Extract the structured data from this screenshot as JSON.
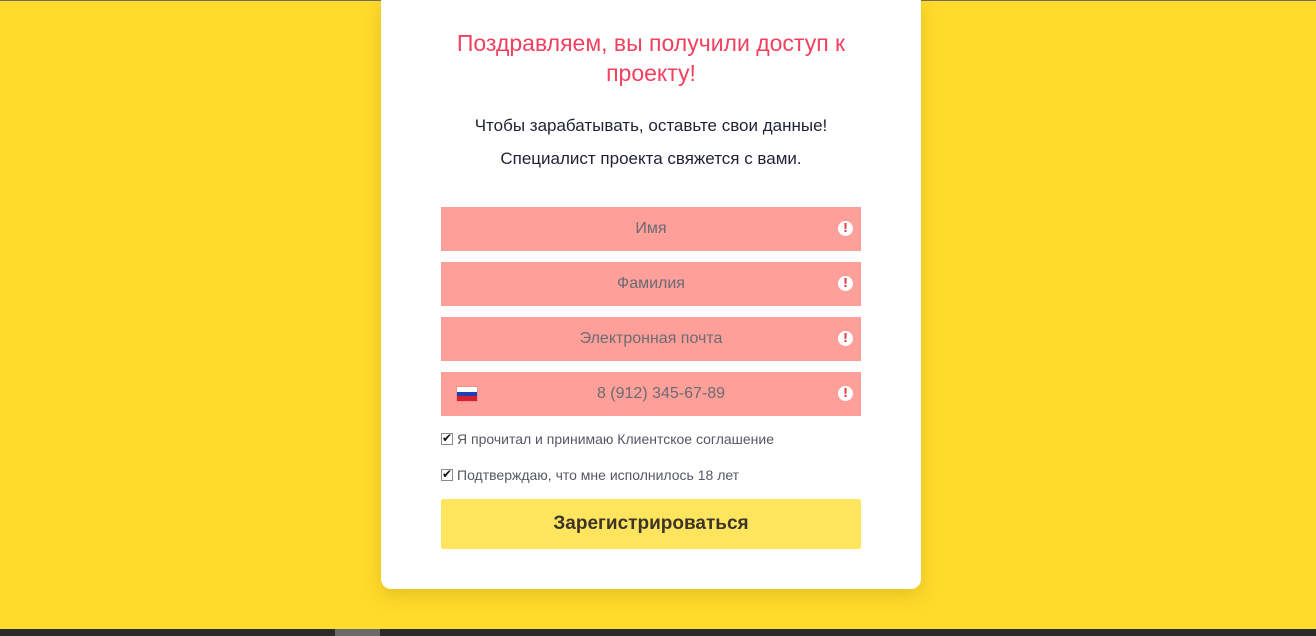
{
  "form": {
    "title": "Поздравляем, вы получили доступ к проекту!",
    "subtitle1": "Чтобы зарабатывать, оставьте свои данные!",
    "subtitle2": "Специалист проекта свяжется с вами.",
    "fields": [
      {
        "placeholder": "Имя",
        "value": "",
        "state": "error",
        "icon": "exclamation-circle-icon"
      },
      {
        "placeholder": "Фамилия",
        "value": "",
        "state": "error",
        "icon": "exclamation-circle-icon"
      },
      {
        "placeholder": "Электронная почта",
        "value": "",
        "state": "error",
        "icon": "exclamation-circle-icon"
      },
      {
        "placeholder": "8 (912) 345-67-89",
        "value": "",
        "state": "error",
        "icon": "exclamation-circle-icon",
        "country_flag": "russia-flag-icon"
      }
    ],
    "checkboxes": [
      {
        "label": "Я прочитал и принимаю Клиентское соглашение",
        "checked": true
      },
      {
        "label": "Подтверждаю, что мне исполнилось 18 лет",
        "checked": true
      }
    ],
    "submit_label": "Зарегистрироваться"
  },
  "colors": {
    "page_background": "#ffdb2b",
    "card_background": "#ffffff",
    "title_color": "#f2405f",
    "field_error_background": "#ff9f99",
    "submit_background": "#ffe55e"
  }
}
